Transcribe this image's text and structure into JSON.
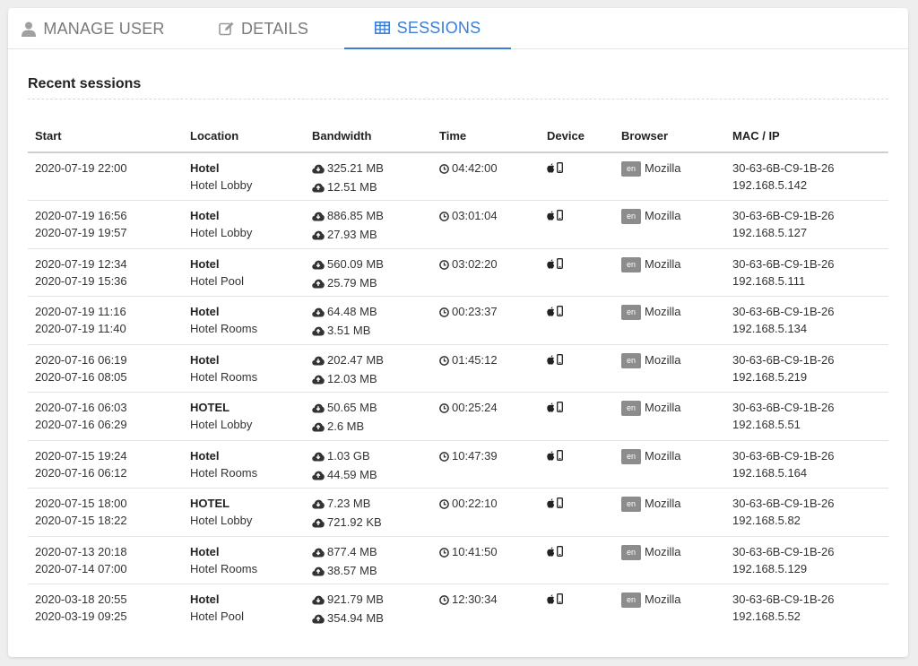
{
  "tabs": [
    {
      "label": "MANAGE USER",
      "icon": "user-icon",
      "active": false
    },
    {
      "label": "DETAILS",
      "icon": "edit-icon",
      "active": false
    },
    {
      "label": "SESSIONS",
      "icon": "table-icon",
      "active": true
    }
  ],
  "colors": {
    "accent": "#3a7fd5",
    "badge": "#8c8c8c"
  },
  "section_title": "Recent sessions",
  "columns": [
    "Start",
    "Location",
    "Bandwidth",
    "Time",
    "Device",
    "Browser",
    "MAC / IP"
  ],
  "icons": {
    "download": "cloud-download-icon",
    "upload": "cloud-upload-icon",
    "time": "clock-icon",
    "device": [
      "apple-icon",
      "mobile-icon"
    ]
  },
  "sessions": [
    {
      "start": "2020-07-19 22:00",
      "end": "",
      "location": "Hotel",
      "area": "Hotel Lobby",
      "download": "325.21 MB",
      "upload": "12.51 MB",
      "time": "04:42:00",
      "lang": "en",
      "browser": "Mozilla",
      "mac": "30-63-6B-C9-1B-26",
      "ip": "192.168.5.142"
    },
    {
      "start": "2020-07-19 16:56",
      "end": "2020-07-19 19:57",
      "location": "Hotel",
      "area": "Hotel Lobby",
      "download": "886.85 MB",
      "upload": "27.93 MB",
      "time": "03:01:04",
      "lang": "en",
      "browser": "Mozilla",
      "mac": "30-63-6B-C9-1B-26",
      "ip": "192.168.5.127"
    },
    {
      "start": "2020-07-19 12:34",
      "end": "2020-07-19 15:36",
      "location": "Hotel",
      "area": "Hotel Pool",
      "download": "560.09 MB",
      "upload": "25.79 MB",
      "time": "03:02:20",
      "lang": "en",
      "browser": "Mozilla",
      "mac": "30-63-6B-C9-1B-26",
      "ip": "192.168.5.111"
    },
    {
      "start": "2020-07-19 11:16",
      "end": "2020-07-19 11:40",
      "location": "Hotel",
      "area": "Hotel Rooms",
      "download": "64.48 MB",
      "upload": "3.51 MB",
      "time": "00:23:37",
      "lang": "en",
      "browser": "Mozilla",
      "mac": "30-63-6B-C9-1B-26",
      "ip": "192.168.5.134"
    },
    {
      "start": "2020-07-16 06:19",
      "end": "2020-07-16 08:05",
      "location": "Hotel",
      "area": "Hotel Rooms",
      "download": "202.47 MB",
      "upload": "12.03 MB",
      "time": "01:45:12",
      "lang": "en",
      "browser": "Mozilla",
      "mac": "30-63-6B-C9-1B-26",
      "ip": "192.168.5.219"
    },
    {
      "start": "2020-07-16 06:03",
      "end": "2020-07-16 06:29",
      "location": "HOTEL",
      "area": "Hotel Lobby",
      "download": "50.65 MB",
      "upload": "2.6 MB",
      "time": "00:25:24",
      "lang": "en",
      "browser": "Mozilla",
      "mac": "30-63-6B-C9-1B-26",
      "ip": "192.168.5.51"
    },
    {
      "start": "2020-07-15 19:24",
      "end": "2020-07-16 06:12",
      "location": "Hotel",
      "area": "Hotel Rooms",
      "download": "1.03 GB",
      "upload": "44.59 MB",
      "time": "10:47:39",
      "lang": "en",
      "browser": "Mozilla",
      "mac": "30-63-6B-C9-1B-26",
      "ip": "192.168.5.164"
    },
    {
      "start": "2020-07-15 18:00",
      "end": "2020-07-15 18:22",
      "location": "HOTEL",
      "area": "Hotel Lobby",
      "download": "7.23 MB",
      "upload": "721.92 KB",
      "time": "00:22:10",
      "lang": "en",
      "browser": "Mozilla",
      "mac": "30-63-6B-C9-1B-26",
      "ip": "192.168.5.82"
    },
    {
      "start": "2020-07-13 20:18",
      "end": "2020-07-14 07:00",
      "location": "Hotel",
      "area": "Hotel Rooms",
      "download": "877.4 MB",
      "upload": "38.57 MB",
      "time": "10:41:50",
      "lang": "en",
      "browser": "Mozilla",
      "mac": "30-63-6B-C9-1B-26",
      "ip": "192.168.5.129"
    },
    {
      "start": "2020-03-18 20:55",
      "end": "2020-03-19 09:25",
      "location": "Hotel",
      "area": "Hotel Pool",
      "download": "921.79 MB",
      "upload": "354.94 MB",
      "time": "12:30:34",
      "lang": "en",
      "browser": "Mozilla",
      "mac": "30-63-6B-C9-1B-26",
      "ip": "192.168.5.52"
    }
  ]
}
